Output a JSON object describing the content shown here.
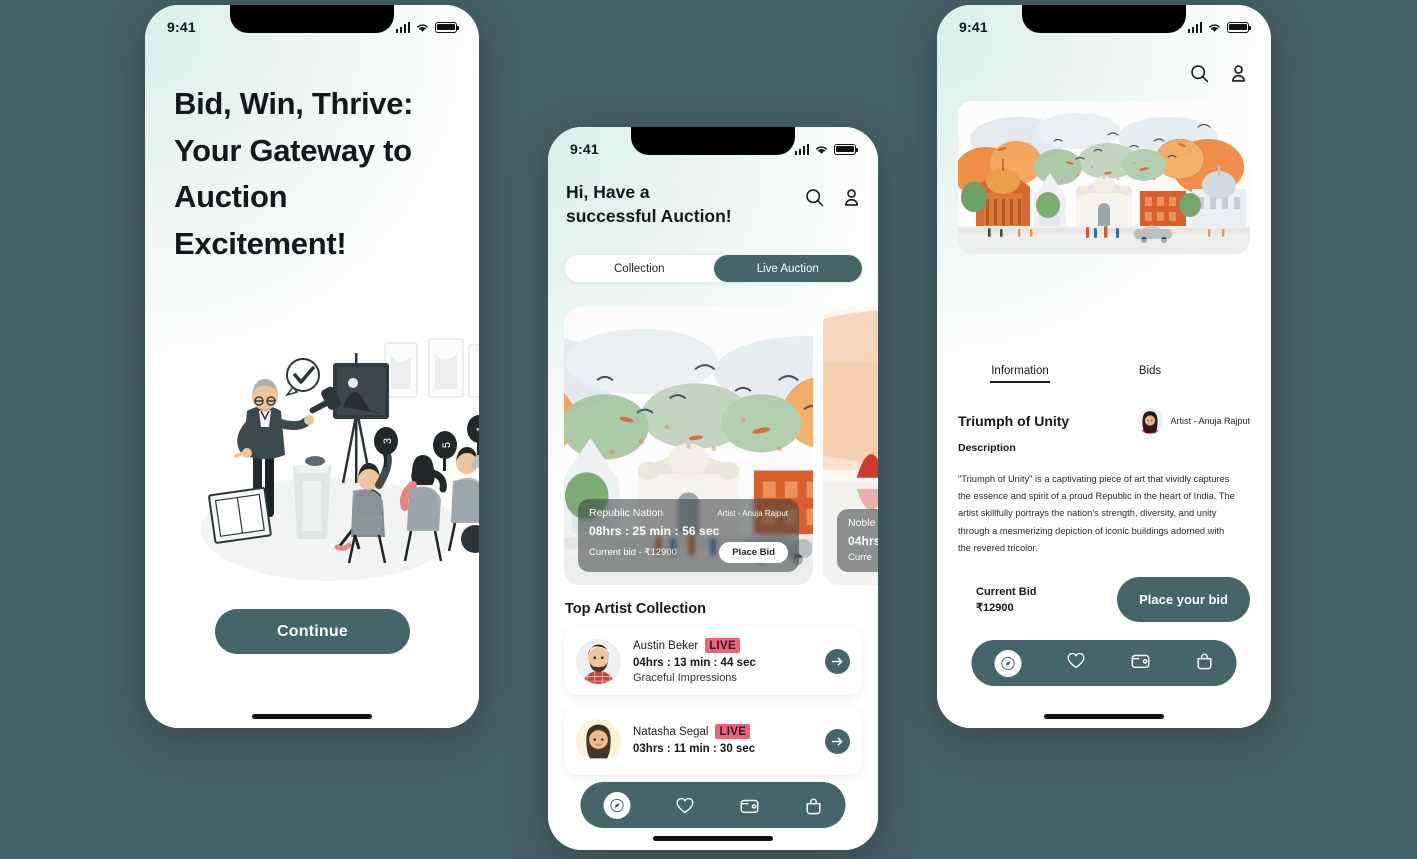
{
  "background_color": "#466166",
  "accent_color": "#44666b",
  "live_badge_color": "#f4607a",
  "status_bar": {
    "time": "9:41"
  },
  "screen1": {
    "headline": "Bid, Win, Thrive: Your Gateway to Auction Excitement!",
    "illustration": "auction-hall-illustration",
    "continue_label": "Continue"
  },
  "screen2": {
    "greeting": "Hi, Have a\nsuccessful Auction!",
    "search_icon": "search-icon",
    "profile_icon": "person-icon",
    "toggle": {
      "options": [
        "Collection",
        "Live Auction"
      ],
      "selected": "Live Auction"
    },
    "cards": [
      {
        "title": "Republic Nation",
        "artist": "Artist - Anuja Rajput",
        "timer": "08hrs : 25 min : 56 sec",
        "current_bid": "Current bid - ₹12900",
        "button": "Place Bid"
      },
      {
        "title": "Noble",
        "artist": "",
        "timer": "04hrs",
        "current_bid": "Curre",
        "button": ""
      }
    ],
    "section_title": "Top Artist Collection",
    "artists": [
      {
        "name": "Austin Beker",
        "badge": "LIVE",
        "timer": "04hrs : 13 min : 44 sec",
        "work": "Graceful Impressions"
      },
      {
        "name": "Natasha Segal",
        "badge": "LIVE",
        "timer": "03hrs : 11 min : 30 sec",
        "work": ""
      }
    ],
    "tabs": [
      "compass-icon",
      "heart-icon",
      "wallet-icon",
      "bag-icon"
    ]
  },
  "screen3": {
    "search_icon": "search-icon",
    "profile_icon": "person-icon",
    "tabs": {
      "items": [
        "Information",
        "Bids"
      ],
      "selected": "Information"
    },
    "title": "Triumph of Unity",
    "artist": "Artist - Anuja Rajput",
    "description_label": "Description",
    "description": "\"Triumph of Unity\" is a captivating piece of art that vividly captures the essence and spirit of a proud Republic in the heart of India. The artist skillfully portrays the nation's strength, diversity, and unity through a mesmerizing depiction of iconic buildings adorned with the revered tricolor.",
    "bid_label": "Current Bid",
    "bid_amount": "₹12900",
    "bid_button": "Place your bid",
    "tabbar": [
      "compass-icon",
      "heart-icon",
      "wallet-icon",
      "bag-icon"
    ]
  }
}
